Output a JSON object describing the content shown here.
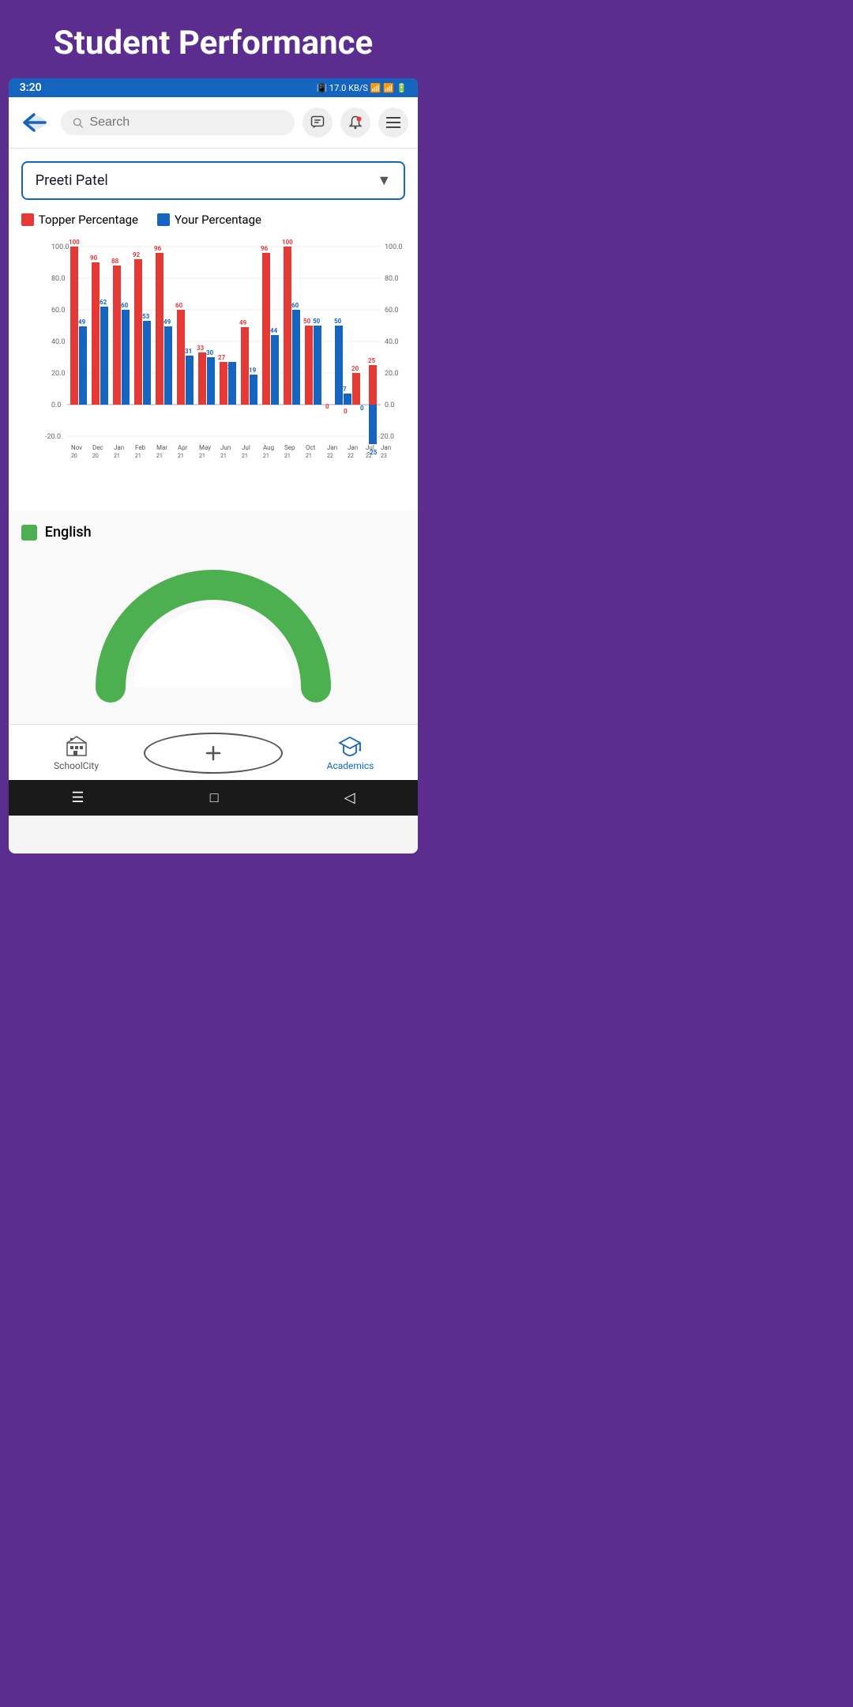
{
  "page": {
    "title": "Student Performance",
    "bg_color": "#5b2d8e"
  },
  "status_bar": {
    "time": "3:20",
    "icons": "📶"
  },
  "nav": {
    "search_placeholder": "Search",
    "back_label": "Back",
    "chat_icon": "💬",
    "bell_icon": "🔔",
    "menu_icon": "☰"
  },
  "student_selector": {
    "selected": "Preeti Patel",
    "options": [
      "Preeti Patel"
    ]
  },
  "chart": {
    "legend": {
      "topper_label": "Topper Percentage",
      "your_label": "Your Percentage",
      "topper_color": "#e53935",
      "your_color": "#1565c0"
    },
    "y_axis_left": [
      "-20.0",
      "0.0",
      "20.0",
      "40.0",
      "60.0",
      "80.0",
      "100.0"
    ],
    "y_axis_right": [
      "-20.0",
      "0.0",
      "20.0",
      "40.0",
      "60.0",
      "80.0",
      "100.0"
    ],
    "bars": [
      {
        "month": "Nov",
        "year": "20",
        "topper": 100,
        "yours": 49
      },
      {
        "month": "Dec",
        "year": "20",
        "topper": 90,
        "yours": 62
      },
      {
        "month": "Jan",
        "year": "21",
        "topper": 88,
        "yours": 60
      },
      {
        "month": "Feb",
        "year": "21",
        "topper": 92,
        "yours": 53
      },
      {
        "month": "Mar",
        "year": "21",
        "topper": 96,
        "yours": 49
      },
      {
        "month": "Apr",
        "year": "21",
        "topper": 60,
        "yours": 31
      },
      {
        "month": "May",
        "year": "21",
        "topper": 33,
        "yours": 30
      },
      {
        "month": "Jun",
        "year": "21",
        "topper": 27,
        "yours": 27
      },
      {
        "month": "Jul",
        "year": "21",
        "topper": 49,
        "yours": 19
      },
      {
        "month": "Aug",
        "year": "21",
        "topper": 96,
        "yours": 44
      },
      {
        "month": "Sep",
        "year": "21",
        "topper": 100,
        "yours": 60
      },
      {
        "month": "Oct",
        "year": "21",
        "topper": 50,
        "yours": 50
      },
      {
        "month": "Jan",
        "year": "22",
        "topper": 0,
        "yours": 50
      },
      {
        "month": "Jan",
        "year": "22",
        "topper": 0,
        "yours": 7
      },
      {
        "month": "Jul",
        "year": "22",
        "topper": 20,
        "yours": 0
      },
      {
        "month": "Jan",
        "year": "23",
        "topper": 25,
        "yours": -25
      }
    ]
  },
  "subject": {
    "name": "English",
    "color": "#4caf50"
  },
  "bottom_nav": {
    "school_city_label": "SchoolCity",
    "add_label": "+",
    "academics_label": "Academics"
  },
  "android_nav": {
    "menu_btn": "☰",
    "home_btn": "□",
    "back_btn": "◁"
  }
}
